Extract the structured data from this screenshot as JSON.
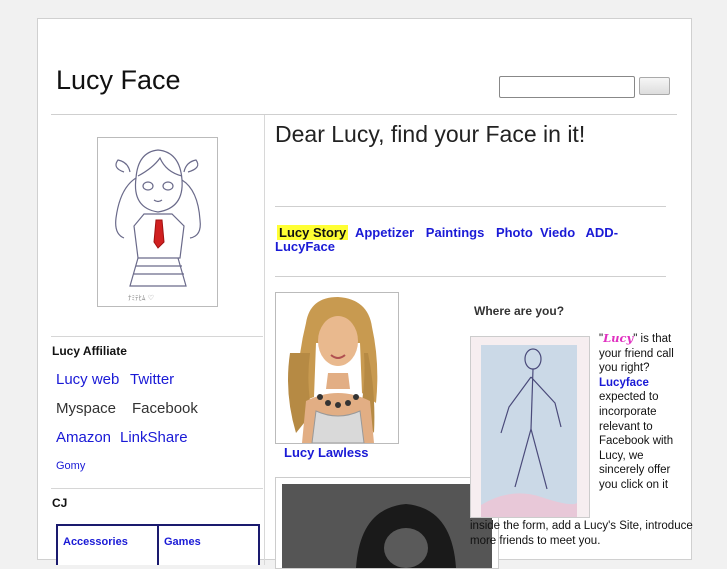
{
  "header": {
    "site_title": "Lucy Face"
  },
  "sidebar": {
    "affiliate_heading": "Lucy Affiliate",
    "links_row1": [
      "Lucy web",
      "Twitter"
    ],
    "links_row2": [
      "Myspace",
      "Facebook"
    ],
    "links_row3": [
      "Amazon",
      "LinkShare"
    ],
    "small_link": "Gomy",
    "cj_heading": "CJ",
    "cj_table": [
      "Accessories",
      "Games"
    ]
  },
  "main": {
    "headline": "Dear Lucy, find your Face in it!",
    "nav": {
      "active": "Lucy Story",
      "items": [
        "Appetizer",
        "Paintings"
      ],
      "photo": "Photo",
      "viedo": "Viedo",
      "add": "ADD-LucyFace"
    },
    "photo_caption": "Lucy Lawless",
    "where_heading": "Where are you?",
    "desc": {
      "quote_open": "\"",
      "lucy": "Lucy",
      "part1": "\" is that your friend call you right?",
      "lucyface": "Lucyface",
      "part2": "expected to incorporate relevant to Facebook with Lucy, we sincerely offer you click on it",
      "part3": "inside the form, add a Lucy's Site, introduce more friends to meet you."
    }
  },
  "colors": {
    "link": "#1a1ad6",
    "highlight": "#ffff33",
    "accent_pink": "#e030c0"
  }
}
